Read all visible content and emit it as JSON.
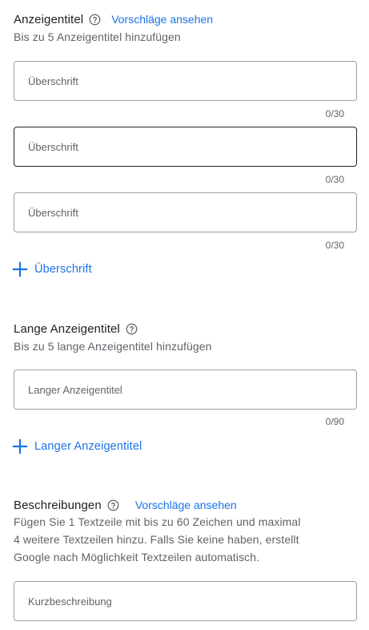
{
  "headlines": {
    "title": "Anzeigentitel",
    "help_icon": "help-circle-icon",
    "suggestions_link": "Vorschläge ansehen",
    "subtitle": "Bis zu 5 Anzeigentitel hinzufügen",
    "fields": [
      {
        "placeholder": "Überschrift",
        "value": "",
        "counter": "0/30",
        "focused": false
      },
      {
        "placeholder": "Überschrift",
        "value": "",
        "counter": "0/30",
        "focused": true
      },
      {
        "placeholder": "Überschrift",
        "value": "",
        "counter": "0/30",
        "focused": false
      }
    ],
    "add_label": "Überschrift",
    "add_icon": "plus-icon"
  },
  "long_headlines": {
    "title": "Lange Anzeigentitel",
    "help_icon": "help-circle-icon",
    "subtitle": "Bis zu 5 lange Anzeigentitel hinzufügen",
    "fields": [
      {
        "placeholder": "Langer Anzeigentitel",
        "value": "",
        "counter": "0/90"
      }
    ],
    "add_label": "Langer Anzeigentitel",
    "add_icon": "plus-icon"
  },
  "descriptions": {
    "title": "Beschreibungen",
    "help_icon": "help-circle-icon",
    "suggestions_link": "Vorschläge ansehen",
    "subtitle_lines": [
      "Fügen Sie 1 Textzeile mit bis zu 60 Zeichen und maximal",
      "4 weitere Textzeilen hinzu. Falls Sie keine haben, erstellt",
      "Google nach Möglichkeit Textzeilen automatisch."
    ],
    "fields": [
      {
        "placeholder": "Kurzbeschreibung",
        "value": ""
      }
    ]
  },
  "colors": {
    "link": "#1a73e8",
    "text": "#202124",
    "secondary_text": "#5f6368",
    "border": "#9aa0a6"
  }
}
